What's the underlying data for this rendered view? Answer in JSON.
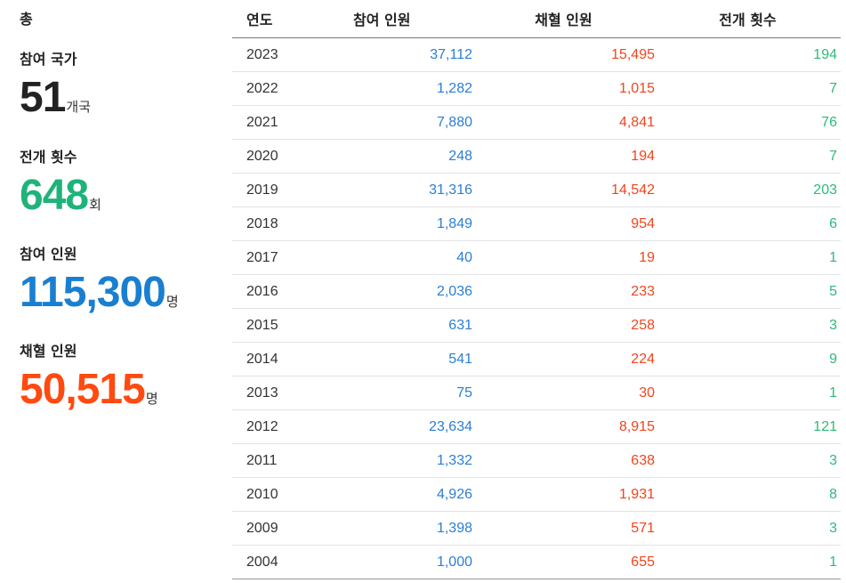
{
  "summary": {
    "heading": "총",
    "countries": {
      "label": "참여 국가",
      "value": "51",
      "unit": "개국"
    },
    "events": {
      "label": "전개 횟수",
      "value": "648",
      "unit": "회"
    },
    "participants": {
      "label": "참여 인원",
      "value": "115,300",
      "unit": "명"
    },
    "hires": {
      "label": "채혈 인원",
      "value": "50,515",
      "unit": "명"
    }
  },
  "colors": {
    "events": "#1fb37a",
    "participants": "#1a7fd0",
    "hires": "#ff4a10",
    "text": "#222222",
    "participants_cell": "#2a7fd4",
    "hires_cell": "#f0451d",
    "events_cell": "#2dbb78"
  },
  "table": {
    "headers": {
      "year": "연도",
      "participants": "참여 인원",
      "hires": "채혈 인원",
      "events": "전개 횟수"
    },
    "rows": [
      {
        "year": "2023",
        "participants": "37,112",
        "hires": "15,495",
        "events": "194"
      },
      {
        "year": "2022",
        "participants": "1,282",
        "hires": "1,015",
        "events": "7"
      },
      {
        "year": "2021",
        "participants": "7,880",
        "hires": "4,841",
        "events": "76"
      },
      {
        "year": "2020",
        "participants": "248",
        "hires": "194",
        "events": "7"
      },
      {
        "year": "2019",
        "participants": "31,316",
        "hires": "14,542",
        "events": "203"
      },
      {
        "year": "2018",
        "participants": "1,849",
        "hires": "954",
        "events": "6"
      },
      {
        "year": "2017",
        "participants": "40",
        "hires": "19",
        "events": "1"
      },
      {
        "year": "2016",
        "participants": "2,036",
        "hires": "233",
        "events": "5"
      },
      {
        "year": "2015",
        "participants": "631",
        "hires": "258",
        "events": "3"
      },
      {
        "year": "2014",
        "participants": "541",
        "hires": "224",
        "events": "9"
      },
      {
        "year": "2013",
        "participants": "75",
        "hires": "30",
        "events": "1"
      },
      {
        "year": "2012",
        "participants": "23,634",
        "hires": "8,915",
        "events": "121"
      },
      {
        "year": "2011",
        "participants": "1,332",
        "hires": "638",
        "events": "3"
      },
      {
        "year": "2010",
        "participants": "4,926",
        "hires": "1,931",
        "events": "8"
      },
      {
        "year": "2009",
        "participants": "1,398",
        "hires": "571",
        "events": "3"
      },
      {
        "year": "2004",
        "participants": "1,000",
        "hires": "655",
        "events": "1"
      }
    ]
  }
}
